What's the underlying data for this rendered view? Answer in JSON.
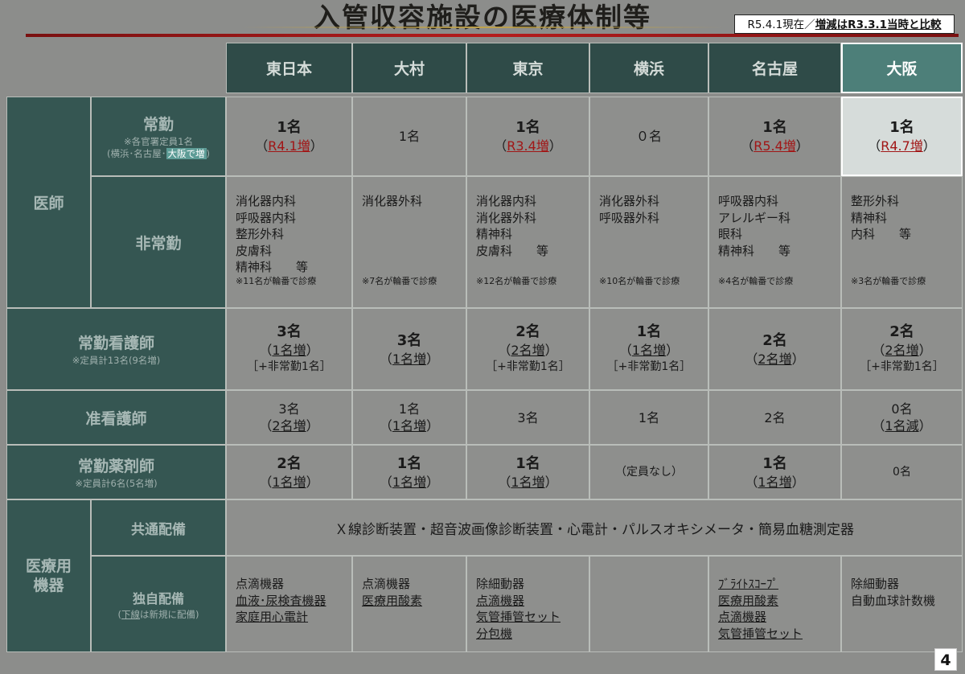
{
  "title": "入管収容施設の医療体制等",
  "datebox": {
    "prefix": "R5.4.1現在／",
    "bold": "増減はR3.3.1当時と比較"
  },
  "columns": [
    "東日本",
    "大村",
    "東京",
    "横浜",
    "名古屋",
    "大阪"
  ],
  "row_headers": {
    "doctor": "医師",
    "fulltime": "常勤",
    "fulltime_note1": "※各官署定員1名",
    "fulltime_note2a": "(横浜･名古屋･",
    "fulltime_note2b": "大阪で増",
    "fulltime_note2c": ")",
    "parttime": "非常勤",
    "nurse": "常勤看護師",
    "nurse_note": "※定員計13名(9名増)",
    "assoc_nurse": "准看護師",
    "pharm": "常勤薬剤師",
    "pharm_note": "※定員計6名(5名増)",
    "equipment": "医療用\n機器",
    "common": "共通配備",
    "own": "独自配備",
    "own_note_a": "(",
    "own_note_b": "下線",
    "own_note_c": "は新規に配備)"
  },
  "fulltime_doctors": [
    {
      "value": "1名",
      "bold": true,
      "sub": "R4.1増"
    },
    {
      "value": "1名",
      "bold": false,
      "sub": ""
    },
    {
      "value": "1名",
      "bold": true,
      "sub": "R3.4増"
    },
    {
      "value": "０名",
      "bold": false,
      "sub": ""
    },
    {
      "value": "1名",
      "bold": true,
      "sub": "R5.4増"
    },
    {
      "value": "1名",
      "bold": true,
      "sub": "R4.7増"
    }
  ],
  "parttime_doctors": [
    {
      "items": [
        "消化器内科",
        "呼吸器内科",
        "整形外科",
        "皮膚科",
        "精神科　　等"
      ],
      "foot": "※11名が輪番で診療"
    },
    {
      "items": [
        "消化器外科"
      ],
      "foot": "※7名が輪番で診療"
    },
    {
      "items": [
        "消化器内科",
        "消化器外科",
        "精神科",
        "皮膚科　　等"
      ],
      "foot": "※12名が輪番で診療"
    },
    {
      "items": [
        "消化器外科",
        "呼吸器外科"
      ],
      "foot": "※10名が輪番で診療"
    },
    {
      "items": [
        "呼吸器内科",
        "アレルギー科",
        "眼科",
        "精神科　　等"
      ],
      "foot": "※4名が輪番で診療"
    },
    {
      "items": [
        "整形外科",
        "精神科",
        "内科　　等"
      ],
      "foot": "※3名が輪番で診療"
    }
  ],
  "nurses": [
    {
      "value": "3名",
      "sub": "1名増",
      "extra": "［+非常勤1名］"
    },
    {
      "value": "3名",
      "sub": "1名増",
      "extra": ""
    },
    {
      "value": "2名",
      "sub": "2名増",
      "extra": "［+非常勤1名］"
    },
    {
      "value": "1名",
      "sub": "1名増",
      "extra": "［+非常勤1名］"
    },
    {
      "value": "2名",
      "sub": "2名増",
      "extra": ""
    },
    {
      "value": "2名",
      "sub": "2名増",
      "extra": "［+非常勤1名］"
    }
  ],
  "assoc_nurses": [
    {
      "value": "3名",
      "sub": "2名増"
    },
    {
      "value": "1名",
      "sub": "1名増"
    },
    {
      "value": "3名",
      "sub": ""
    },
    {
      "value": "1名",
      "sub": ""
    },
    {
      "value": "2名",
      "sub": ""
    },
    {
      "value": "0名",
      "sub": "1名減"
    }
  ],
  "pharmacists": [
    {
      "value": "2名",
      "bold": true,
      "sub": "1名増"
    },
    {
      "value": "1名",
      "bold": true,
      "sub": "1名増"
    },
    {
      "value": "1名",
      "bold": true,
      "sub": "1名増"
    },
    {
      "value": "（定員なし）",
      "bold": false,
      "sub": ""
    },
    {
      "value": "1名",
      "bold": true,
      "sub": "1名増"
    },
    {
      "value": "0名",
      "bold": false,
      "sub": ""
    }
  ],
  "common_equipment": "Ｘ線診断装置・超音波画像診断装置・心電計・パルスオキシメータ・簡易血糖測定器",
  "own_equipment": [
    [
      {
        "t": "点滴機器",
        "u": false
      },
      {
        "t": "血液･尿検査機器",
        "u": true
      },
      {
        "t": "家庭用心電計",
        "u": true
      }
    ],
    [
      {
        "t": "点滴機器",
        "u": false
      },
      {
        "t": "医療用酸素",
        "u": true
      }
    ],
    [
      {
        "t": "除細動器",
        "u": false
      },
      {
        "t": "点滴機器",
        "u": true
      },
      {
        "t": "気管挿管セット",
        "u": true
      },
      {
        "t": "分包機",
        "u": true
      }
    ],
    [],
    [
      {
        "t": "ﾌﾞﾗｲﾄｽｺｰﾌﾟ",
        "u": true
      },
      {
        "t": "医療用酸素",
        "u": true
      },
      {
        "t": "点滴機器",
        "u": true
      },
      {
        "t": "気管挿管セット",
        "u": true
      }
    ],
    [
      {
        "t": "除細動器",
        "u": false
      },
      {
        "t": "自動血球計数機",
        "u": false
      }
    ]
  ],
  "page_number": "4",
  "colors": {
    "header": "#2f4b48",
    "header_highlight": "#4d7f79",
    "row_header": "#355652",
    "cell": "#8e8f8d",
    "title_rule": "#b51c1c",
    "increase_red": "#a11616"
  }
}
